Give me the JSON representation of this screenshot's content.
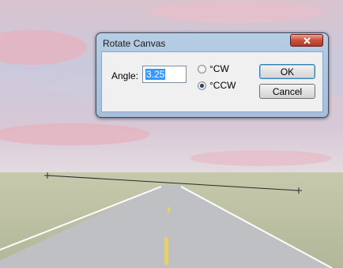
{
  "dialog": {
    "title": "Rotate Canvas",
    "angle_label": "Angle:",
    "angle_value": "3.25",
    "options": [
      {
        "label": "°CW",
        "selected": false
      },
      {
        "label": "°CCW",
        "selected": true
      }
    ],
    "ok_label": "OK",
    "cancel_label": "Cancel",
    "close_icon": "close-x-icon"
  },
  "colors": {
    "titlebar": "#b7cde4",
    "close_button": "#c9503a",
    "selection": "#3399ff"
  }
}
